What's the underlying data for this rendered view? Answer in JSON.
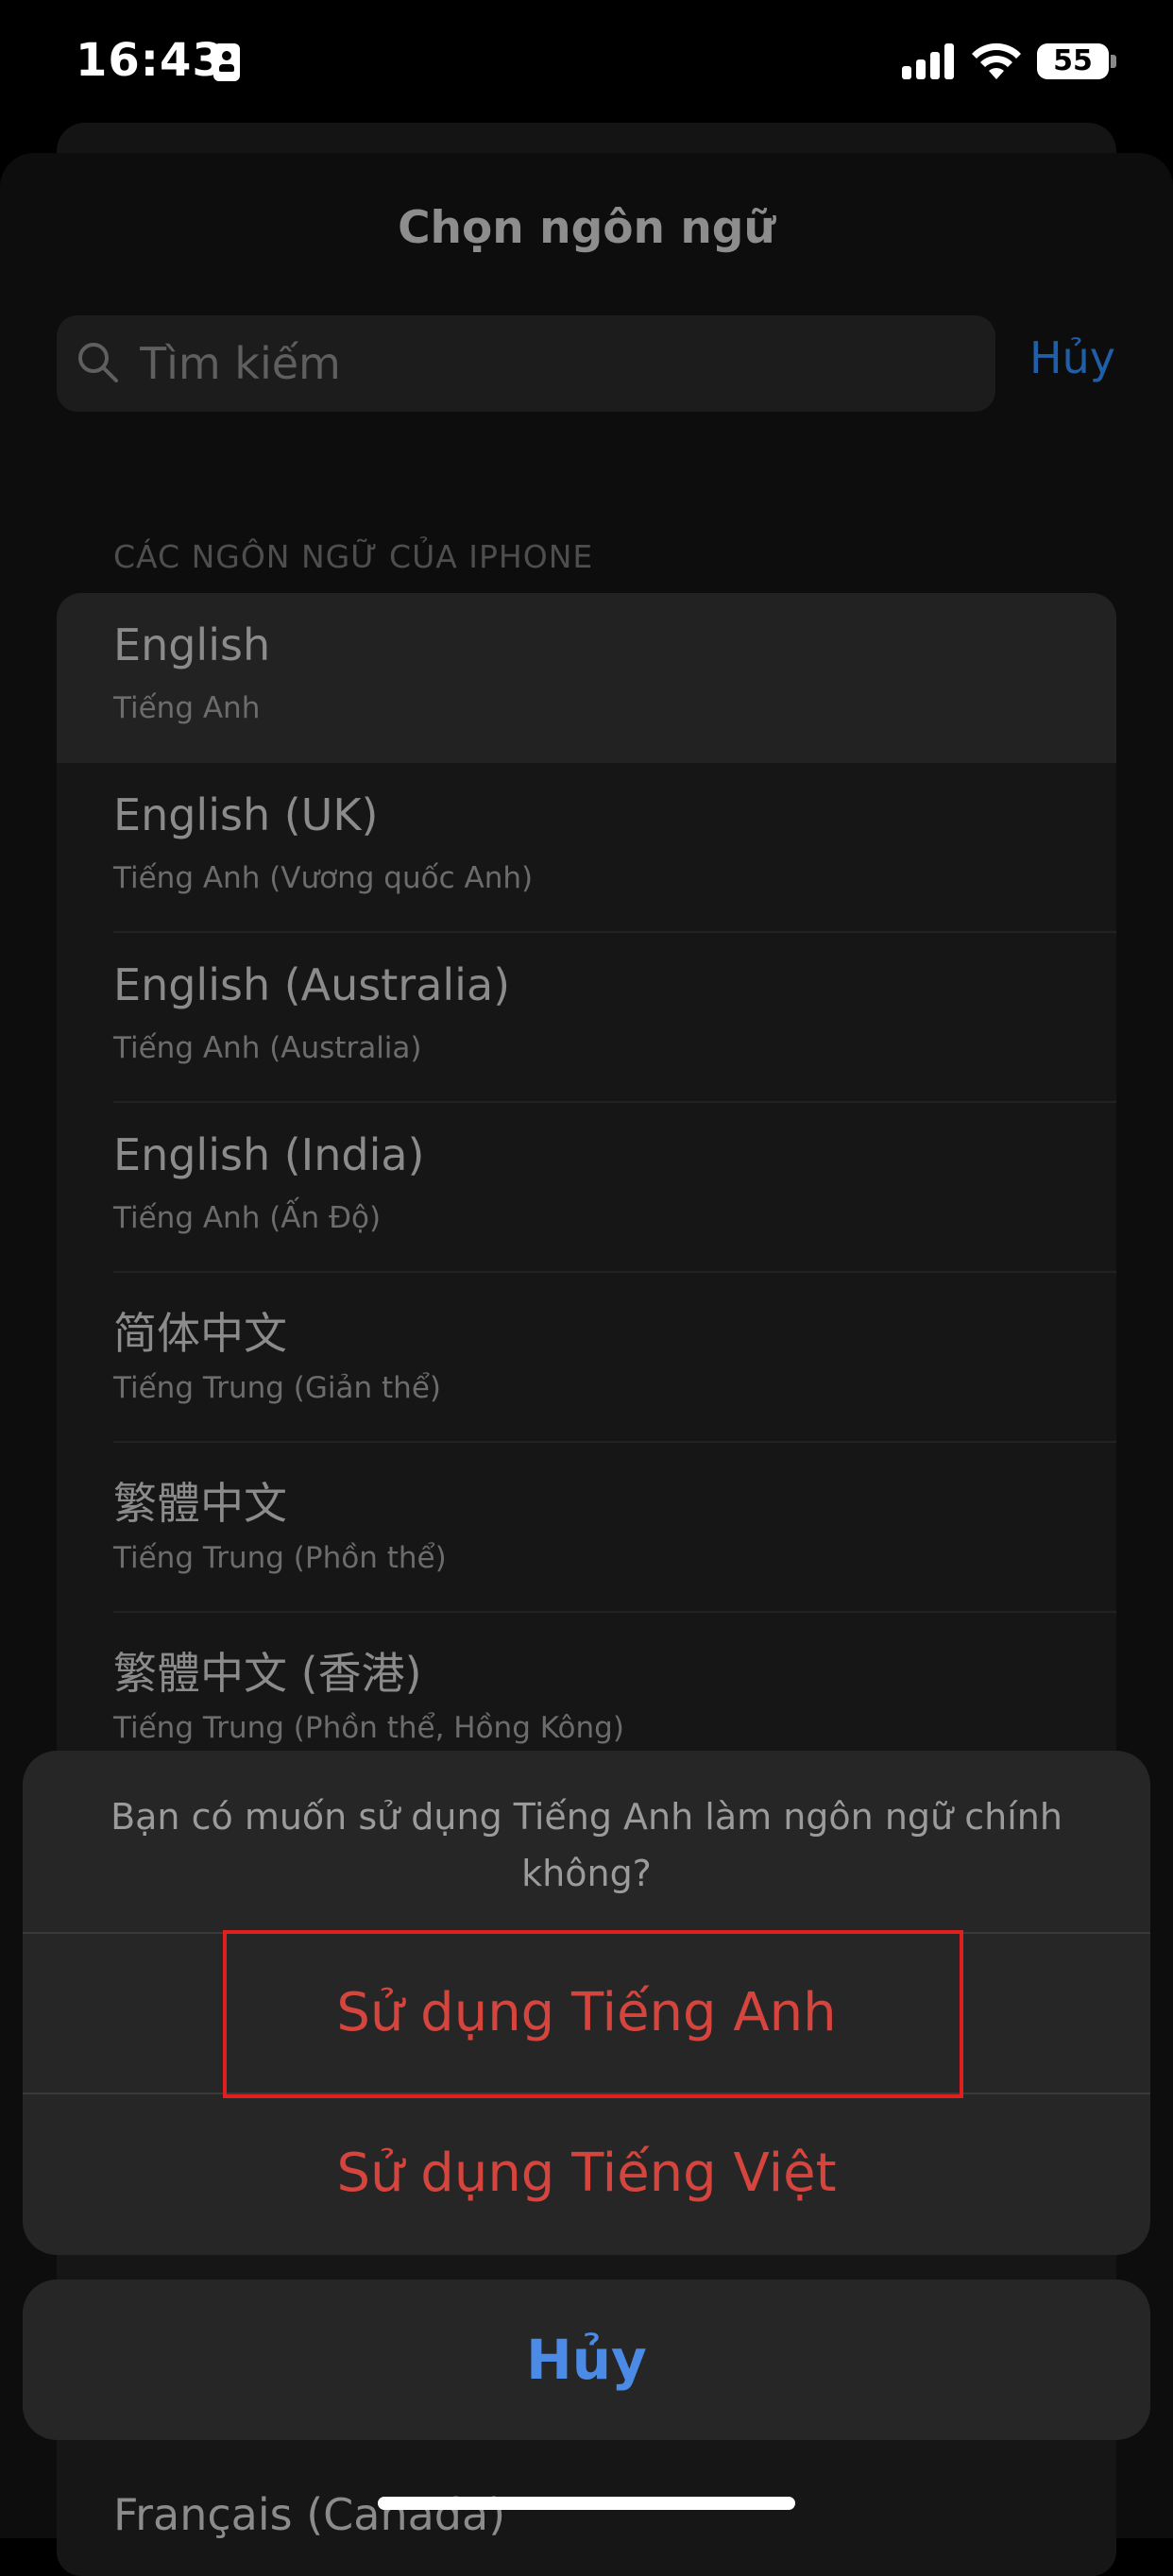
{
  "status_bar": {
    "time": "16:43",
    "battery": "55",
    "sim_icon": "sim-card-icon",
    "signal_icon": "cellular-signal-icon",
    "wifi_icon": "wifi-icon"
  },
  "sheet": {
    "title": "Chọn ngôn ngữ",
    "search": {
      "placeholder": "Tìm kiếm",
      "value": "",
      "icon": "search-icon"
    },
    "cancel_label": "Hủy",
    "section_header": "CÁC NGÔN NGỮ CỦA IPHONE",
    "languages": [
      {
        "name": "English",
        "subtitle": "Tiếng Anh",
        "selected": true
      },
      {
        "name": "English (UK)",
        "subtitle": "Tiếng Anh (Vương quốc Anh)"
      },
      {
        "name": "English (Australia)",
        "subtitle": "Tiếng Anh (Australia)"
      },
      {
        "name": "English (India)",
        "subtitle": "Tiếng Anh (Ấn Độ)"
      },
      {
        "name": "简体中文",
        "subtitle": "Tiếng Trung (Giản thể)"
      },
      {
        "name": "繁體中文",
        "subtitle": "Tiếng Trung (Phồn thể)"
      },
      {
        "name": "繁體中文 (香港)",
        "subtitle": "Tiếng Trung (Phồn thể, Hồng Kông)"
      }
    ],
    "partially_visible_item": "Français (Canada)"
  },
  "action_sheet": {
    "message": "Bạn có muốn sử dụng Tiếng Anh làm ngôn ngữ chính không?",
    "option_primary": "Sử dụng Tiếng Anh",
    "option_secondary": "Sử dụng Tiếng Việt",
    "cancel": "Hủy"
  },
  "colors": {
    "destructive": "#d6453d",
    "accent": "#4b8be6",
    "highlight": "#e0201f"
  }
}
